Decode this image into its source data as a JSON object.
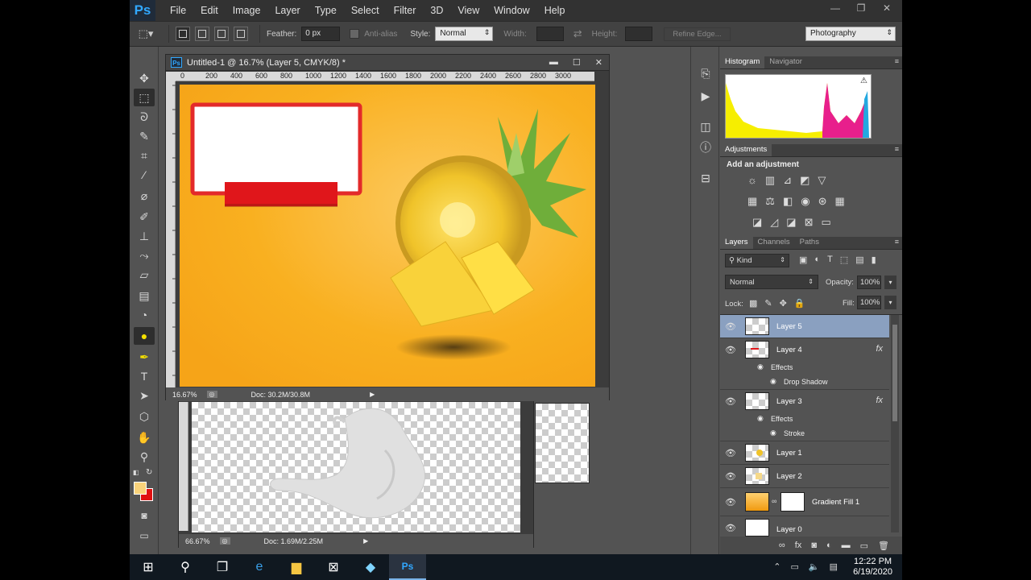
{
  "app": {
    "logo": "Ps",
    "menus": [
      "File",
      "Edit",
      "Image",
      "Layer",
      "Type",
      "Select",
      "Filter",
      "3D",
      "View",
      "Window",
      "Help"
    ],
    "window_controls": [
      "—",
      "❐",
      "✕"
    ]
  },
  "options_bar": {
    "feather_label": "Feather:",
    "feather_value": "0 px",
    "antialias_label": "Anti-alias",
    "style_label": "Style:",
    "style_value": "Normal",
    "width_label": "Width:",
    "height_label": "Height:",
    "refine_edge": "Refine Edge...",
    "workspace": "Photography"
  },
  "document_main": {
    "title": "Untitled-1 @ 16.7% (Layer 5, CMYK/8) *",
    "ruler_ticks": [
      "0",
      "200",
      "400",
      "600",
      "800",
      "1000",
      "1200",
      "1400",
      "1600",
      "1800",
      "2000",
      "2200",
      "2400",
      "2600",
      "2800",
      "3000"
    ],
    "zoom": "16.67%",
    "doc_info": "Doc: 30.2M/30.8M",
    "colors": {
      "background": "#f9ab1d",
      "frame": "#e32a2a",
      "banner": "#e0161b"
    }
  },
  "document_back": {
    "zoom": "66.67%",
    "doc_info": "Doc: 1.69M/2.25M"
  },
  "histogram_panel": {
    "tabs": [
      "Histogram",
      "Navigator"
    ]
  },
  "adjustments_panel": {
    "tab": "Adjustments",
    "heading": "Add an adjustment"
  },
  "layers_panel": {
    "tabs": [
      "Layers",
      "Channels",
      "Paths"
    ],
    "kind": "Kind",
    "blend_mode": "Normal",
    "opacity_label": "Opacity:",
    "opacity_value": "100%",
    "lock_label": "Lock:",
    "fill_label": "Fill:",
    "fill_value": "100%",
    "layers": [
      {
        "name": "Layer 5"
      },
      {
        "name": "Layer 4",
        "fx": "fx",
        "effects_label": "Effects",
        "effect": "Drop Shadow"
      },
      {
        "name": "Layer 3",
        "fx": "fx",
        "effects_label": "Effects",
        "effect": "Stroke"
      },
      {
        "name": "Layer 1"
      },
      {
        "name": "Layer 2"
      },
      {
        "name": "Gradient Fill 1"
      },
      {
        "name": "Layer 0"
      }
    ]
  },
  "taskbar": {
    "time": "12:22 PM",
    "date": "6/19/2020"
  }
}
